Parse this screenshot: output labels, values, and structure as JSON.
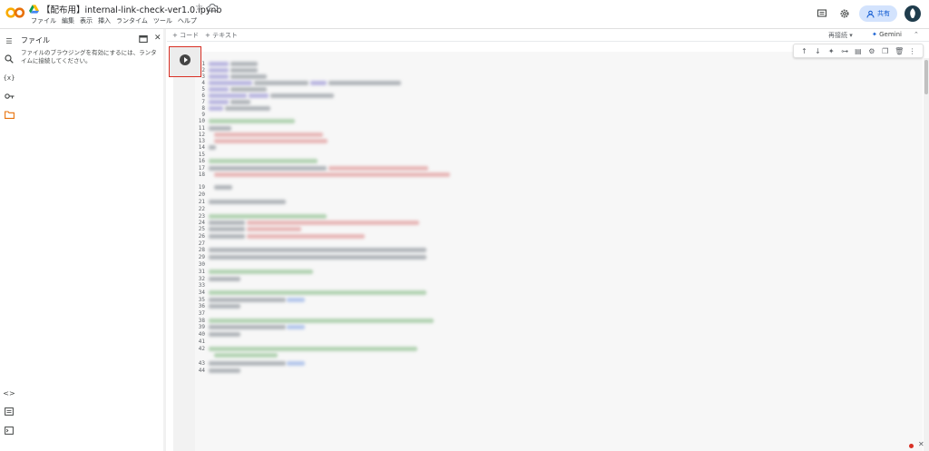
{
  "header": {
    "title": "【配布用】internal-link-check-ver1.0.ipynb",
    "menu": [
      "ファイル",
      "編集",
      "表示",
      "挿入",
      "ランタイム",
      "ツール",
      "ヘルプ"
    ],
    "share_label": "共有",
    "icons": [
      "colab-logo",
      "drive-icon",
      "star-icon",
      "cloud-icon",
      "comment-icon",
      "settings-icon",
      "person-icon",
      "avatar"
    ]
  },
  "sidebar": {
    "rail_icons": [
      "table-of-contents-icon",
      "search-icon",
      "variables-icon",
      "secrets-key-icon",
      "folder-icon",
      "code-snippets-icon",
      "command-palette-icon",
      "terminal-icon"
    ],
    "panel_title": "ファイル",
    "panel_message": "ファイルのブラウジングを有効にするには、ランタイムに接続してください。"
  },
  "toolbar": {
    "add_code": "+ コード",
    "add_text": "+ テキスト",
    "reconnect": "再接続",
    "gemini": "Gemini"
  },
  "cell": {
    "line_numbers": [
      "1",
      "2",
      "3",
      "4",
      "5",
      "6",
      "7",
      "8",
      "9",
      "10",
      "11",
      "12",
      "13",
      "14",
      "15",
      "16",
      "17",
      "18",
      "19",
      "20",
      "21",
      "22",
      "23",
      "24",
      "25",
      "26",
      "27",
      "28",
      "29",
      "30",
      "31",
      "32",
      "33",
      "34",
      "35",
      "36",
      "37",
      "38",
      "39",
      "40",
      "41",
      "42",
      "43",
      "44"
    ],
    "toolbar_icons": [
      "move-up-icon",
      "move-down-icon",
      "gemini-spark-icon",
      "link-icon",
      "comment-icon",
      "settings-icon",
      "mirror-cell-icon",
      "delete-icon",
      "more-icon"
    ],
    "code_colors": {
      "keyword": "#a5a0d8",
      "plain": "#9aa0a6",
      "string": "#e3a3a3",
      "comment": "#9cc79c",
      "link": "#9fb8e8"
    }
  }
}
